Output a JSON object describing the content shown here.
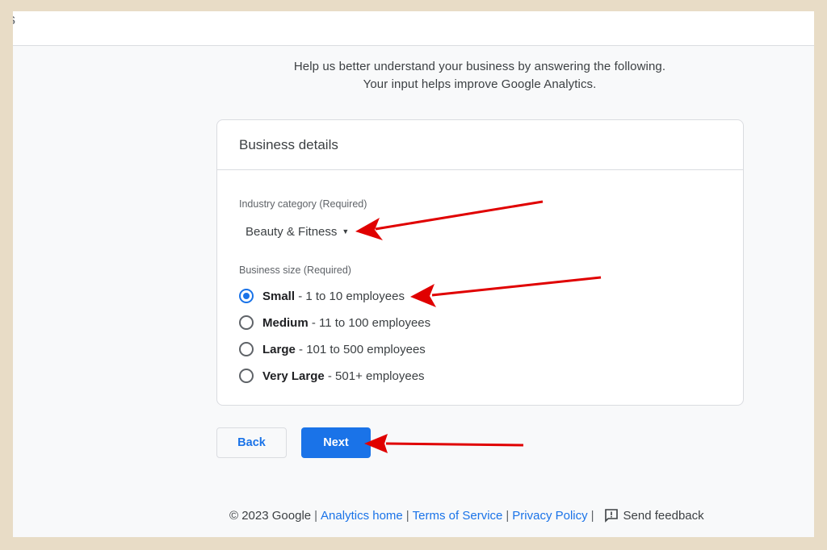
{
  "intro": {
    "line1": "Help us better understand your business by answering the following.",
    "line2": "Your input helps improve Google Analytics."
  },
  "card": {
    "title": "Business details",
    "industry_label": "Industry category (Required)",
    "industry_value": "Beauty & Fitness",
    "size_label": "Business size (Required)",
    "size_options": [
      {
        "name": "Small",
        "desc": " - 1 to 10 employees",
        "checked": true
      },
      {
        "name": "Medium",
        "desc": " - 11 to 100 employees",
        "checked": false
      },
      {
        "name": "Large",
        "desc": " - 101 to 500 employees",
        "checked": false
      },
      {
        "name": "Very Large",
        "desc": " - 501+ employees",
        "checked": false
      }
    ]
  },
  "buttons": {
    "back": "Back",
    "next": "Next"
  },
  "footer": {
    "copyright": "© 2023 Google",
    "links": [
      "Analytics home",
      "Terms of Service",
      "Privacy Policy"
    ],
    "feedback": "Send feedback"
  },
  "colors": {
    "accent": "#1a73e8",
    "annotation_arrow": "#e00000"
  },
  "icons": {
    "dropdown": "caret-down-icon",
    "feedback": "feedback-icon"
  }
}
